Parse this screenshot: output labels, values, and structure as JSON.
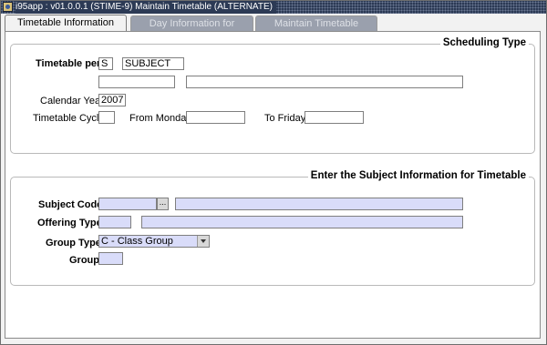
{
  "window": {
    "title": "i95app : v01.0.0.1 (STIME-9) Maintain Timetable  (ALTERNATE)",
    "icon": "app-icon"
  },
  "tabs": [
    {
      "label": "Timetable Information",
      "active": true
    },
    {
      "label": "Day Information for Timetable",
      "active": false
    },
    {
      "label": "Maintain Timetable",
      "active": false
    }
  ],
  "scheduling": {
    "title": "Scheduling Type",
    "timetable_per_label": "Timetable per",
    "timetable_per_code": "S",
    "timetable_per_value": "SUBJECT",
    "row2_field1": "",
    "row2_field2": "",
    "calendar_year_label": "Calendar Year",
    "calendar_year": "2007",
    "timetable_cycle_label": "Timetable Cycle",
    "timetable_cycle": "",
    "from_monday_label": "From Monday",
    "from_monday": "",
    "to_friday_label": "To Friday",
    "to_friday": ""
  },
  "subject": {
    "title": "Enter the Subject Information for Timetable",
    "subject_code_label": "Subject Code",
    "subject_code": "",
    "lov_label": "...",
    "subject_desc": "",
    "offering_type_label": "Offering Type",
    "offering_type": "",
    "offering_desc": "",
    "group_type_label": "Group Type",
    "group_type_selected": "C - Class Group",
    "group_label": "Group",
    "group": ""
  }
}
